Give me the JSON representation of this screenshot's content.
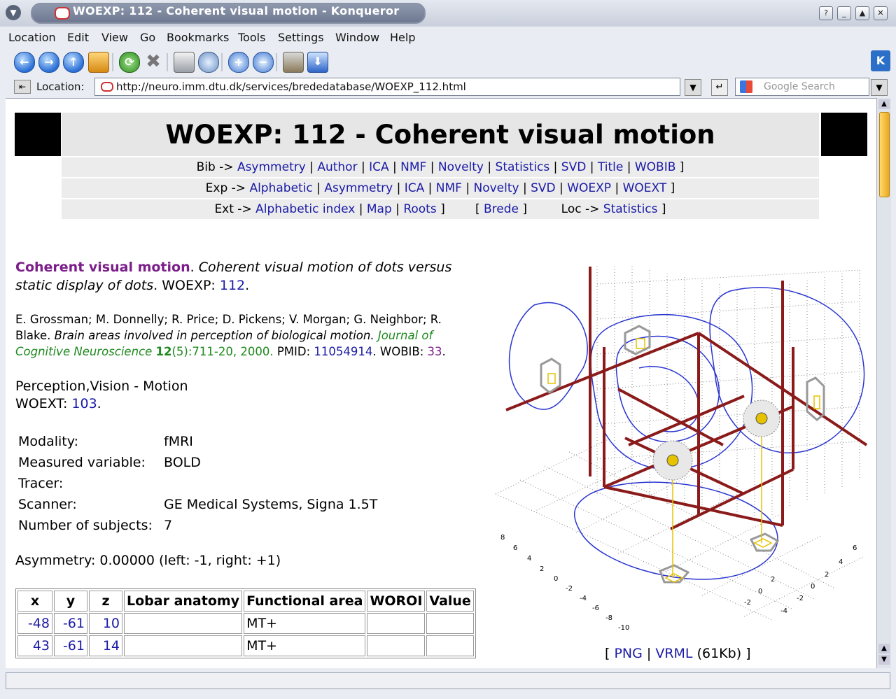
{
  "window": {
    "title": "WOEXP: 112 - Coherent visual motion - Konqueror",
    "controls": [
      "?",
      "_",
      "▲",
      "✕"
    ]
  },
  "menubar": [
    "Location",
    "Edit",
    "View",
    "Go",
    "Bookmarks",
    "Tools",
    "Settings",
    "Window",
    "Help"
  ],
  "locationbar": {
    "label": "Location:",
    "url": "http://neuro.imm.dtu.dk/services/brededatabase/WOEXP_112.html",
    "search_placeholder": "Google Search"
  },
  "page": {
    "title": "WOEXP: 112 - Coherent visual motion",
    "nav_bib": {
      "prefix": "Bib ->",
      "links": [
        "Asymmetry",
        "Author",
        "ICA",
        "NMF",
        "Novelty",
        "Statistics",
        "SVD",
        "Title",
        "WOBIB"
      ]
    },
    "nav_exp": {
      "prefix": "Exp ->",
      "links": [
        "Alphabetic",
        "Asymmetry",
        "ICA",
        "NMF",
        "Novelty",
        "SVD",
        "WOEXP",
        "WOEXT"
      ]
    },
    "nav_ext": {
      "prefix": "Ext ->",
      "links": [
        "Alphabetic index",
        "Map",
        "Roots"
      ],
      "brede": "Brede",
      "loc_prefix": "Loc ->",
      "loc_link": "Statistics"
    },
    "heading_name": "Coherent visual motion",
    "heading_desc": "Coherent visual motion of dots versus",
    "heading_desc2": "static display of dots",
    "woexp_label": "WOEXP:",
    "woexp_id": "112",
    "authors1": "E. Grossman; M. Donnelly; R. Price; D. Pickens; V. Morgan; G. Neighbor; R.",
    "authors2": "Blake.",
    "paper_title": "Brain areas involved in perception of biological motion.",
    "journal1": "Journal of",
    "journal2": "Cognitive Neuroscience",
    "volume": "12",
    "pages": "(5):711-20, 2000.",
    "pmid_label": "PMID:",
    "pmid": "11054914",
    "wobib_label": "WOBIB:",
    "wobib": "33",
    "category": "Perception,Vision - Motion",
    "woext_label": "WOEXT:",
    "woext": "103",
    "details": [
      {
        "k": "Modality:",
        "v": "fMRI"
      },
      {
        "k": "Measured variable:",
        "v": "BOLD"
      },
      {
        "k": "Tracer:",
        "v": ""
      },
      {
        "k": "Scanner:",
        "v": "GE Medical Systems, Signa 1.5T"
      },
      {
        "k": "Number of subjects:",
        "v": "7"
      }
    ],
    "asymmetry": "Asymmetry: 0.00000 (left: -1, right: +1)",
    "table": {
      "headers": [
        "x",
        "y",
        "z",
        "Lobar anatomy",
        "Functional area",
        "WOROI",
        "Value"
      ],
      "rows": [
        [
          "-48",
          "-61",
          "10",
          "",
          "MT+",
          "",
          ""
        ],
        [
          "43",
          "-61",
          "14",
          "",
          "MT+",
          "",
          ""
        ]
      ]
    },
    "figure_links": {
      "png": "PNG",
      "vrml": "VRML",
      "size": "(61Kb)"
    }
  },
  "colors": {
    "link": "#1a1aa6",
    "purple": "#7b1e8a",
    "journal": "#1f8a1f",
    "axes": "#8b1a1a",
    "contour": "#2a35d0"
  }
}
